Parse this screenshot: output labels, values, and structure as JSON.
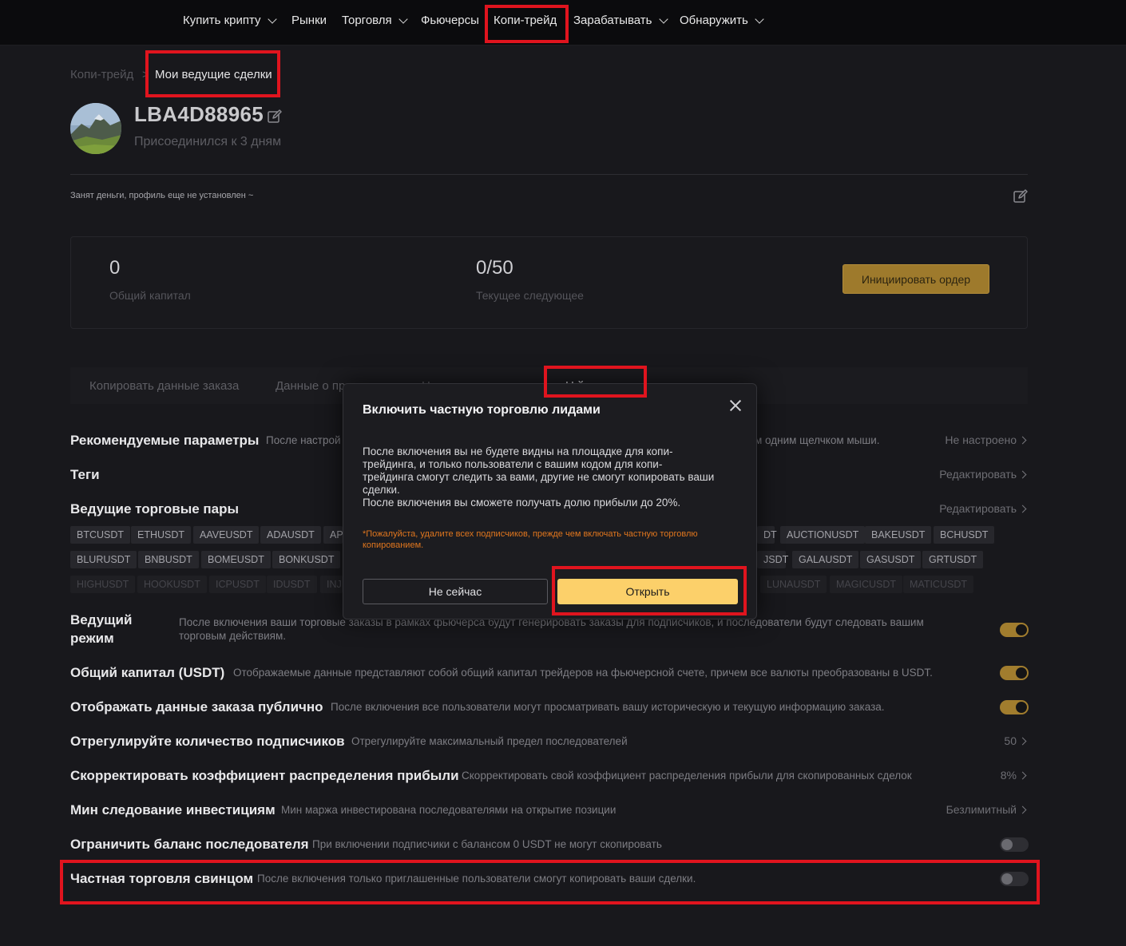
{
  "nav": {
    "buy_crypto": "Купить крипту",
    "markets": "Рынки",
    "trading": "Торговля",
    "futures": "Фьючерсы",
    "copy_trade": "Копи-трейд",
    "earn": "Зарабатывать",
    "discover": "Обнаружить"
  },
  "breadcrumb": {
    "parent": "Копи-трейд",
    "separator": ">",
    "current": "Мои ведущие сделки"
  },
  "profile": {
    "username": "LBA4D88965",
    "joined": "Присоединился к 3 дням",
    "bio": "Занят деньги, профиль еще не установлен ~"
  },
  "stats": {
    "total_capital_value": "0",
    "total_capital_label": "Общий капитал",
    "followers_value": "0/50",
    "followers_label": "Текущее следующее",
    "initiate_button": "Инициировать ордер"
  },
  "tabs": {
    "copy_data": "Копировать данные заказа",
    "profile_data": "Данные о пр",
    "hidden_tab": "Н",
    "settings": "Н    й"
  },
  "settings": {
    "recommended": {
      "title": "Рекомендуемые параметры",
      "desc_left": "После настрой",
      "desc_right": "м одним щелчком мыши.",
      "value": "Не настроено"
    },
    "tags": {
      "title": "Теги",
      "action": "Редактировать"
    },
    "pairs": {
      "title": "Ведущие торговые пары",
      "action": "Редактировать",
      "row1_left": [
        "BTCUSDT",
        "ETHUSDT",
        "AAVEUSDT",
        "ADAUSDT",
        "AP"
      ],
      "row1_right": [
        "DT",
        "AUCTIONUSDT",
        "BAKEUSDT",
        "BCHUSDT"
      ],
      "row2_left": [
        "BLURUSDT",
        "BNBUSDT",
        "BOMEUSDT",
        "BONKUSDT"
      ],
      "row2_right": [
        "JSDT",
        "GALAUSDT",
        "GASUSDT",
        "GRTUSDT"
      ],
      "row3_left": [
        "HIGHUSDT",
        "HOOKUSDT",
        "ICPUSDT",
        "IDUSDT",
        "INJ"
      ],
      "row3_right": [
        "LUNAUSDT",
        "MAGICUSDT",
        "MATICUSDT"
      ]
    },
    "lead_mode": {
      "title_line1": "Ведущий",
      "title_line2": "режим",
      "desc_line1": "После включения ваши торговые заказы в рамках фьючерса будут генерировать заказы для подписчиков, и последователи будут следовать вашим",
      "desc_line2": "торговым действиям."
    },
    "total_capital": {
      "title": "Общий капитал (USDT)",
      "desc": "Отображаемые данные представляют собой общий капитал трейдеров на фьючерсной счете, причем все валюты преобразованы в USDT."
    },
    "public_orders": {
      "title": "Отображать данные заказа публично",
      "desc": "После включения все пользователи могут просматривать вашу историческую и текущую информацию заказа."
    },
    "followers_count": {
      "title": "Отрегулируйте количество подписчиков",
      "desc": "Отрегулируйте максимальный предел последователей",
      "value": "50"
    },
    "profit_share": {
      "title": "Скорректировать коэффициент распределения прибыли",
      "desc": "Скорректировать свой коэффициент распределения прибыли для скопированных сделок",
      "value": "8%"
    },
    "min_invest": {
      "title": "Мин следование инвестициям",
      "desc": "Мин маржа инвестирована последователями на открытие позиции",
      "value": "Безлимитный"
    },
    "limit_balance": {
      "title": "Ограничить баланс последователя",
      "desc": "При включении подписчики с балансом 0 USDT не могут скопировать"
    },
    "private_lead": {
      "title": "Частная торговля свинцом",
      "desc": "После включения только приглашенные пользователи смогут копировать ваши сделки."
    }
  },
  "modal": {
    "title": "Включить частную торговлю лидами",
    "body_line1": "После включения вы не будете видны на площадке для копи-",
    "body_line2": "трейдинга, и только пользователи с вашим кодом для копи-",
    "body_line3": "трейдинга смогут следить за вами, другие не смогут копировать ваши",
    "body_line4": "сделки.",
    "body_line5": "После включения вы сможете получать долю прибыли до 20%.",
    "warning_line1": "*Пожалуйста, удалите всех подписчиков, прежде чем включать частную торговлю",
    "warning_line2": "копированием.",
    "cancel": "Не сейчас",
    "confirm": "Открыть"
  },
  "colors": {
    "accent": "#fcd06a",
    "toggle_on": "#a17d2e",
    "highlight": "#e0141e",
    "warning": "#e0761e"
  }
}
